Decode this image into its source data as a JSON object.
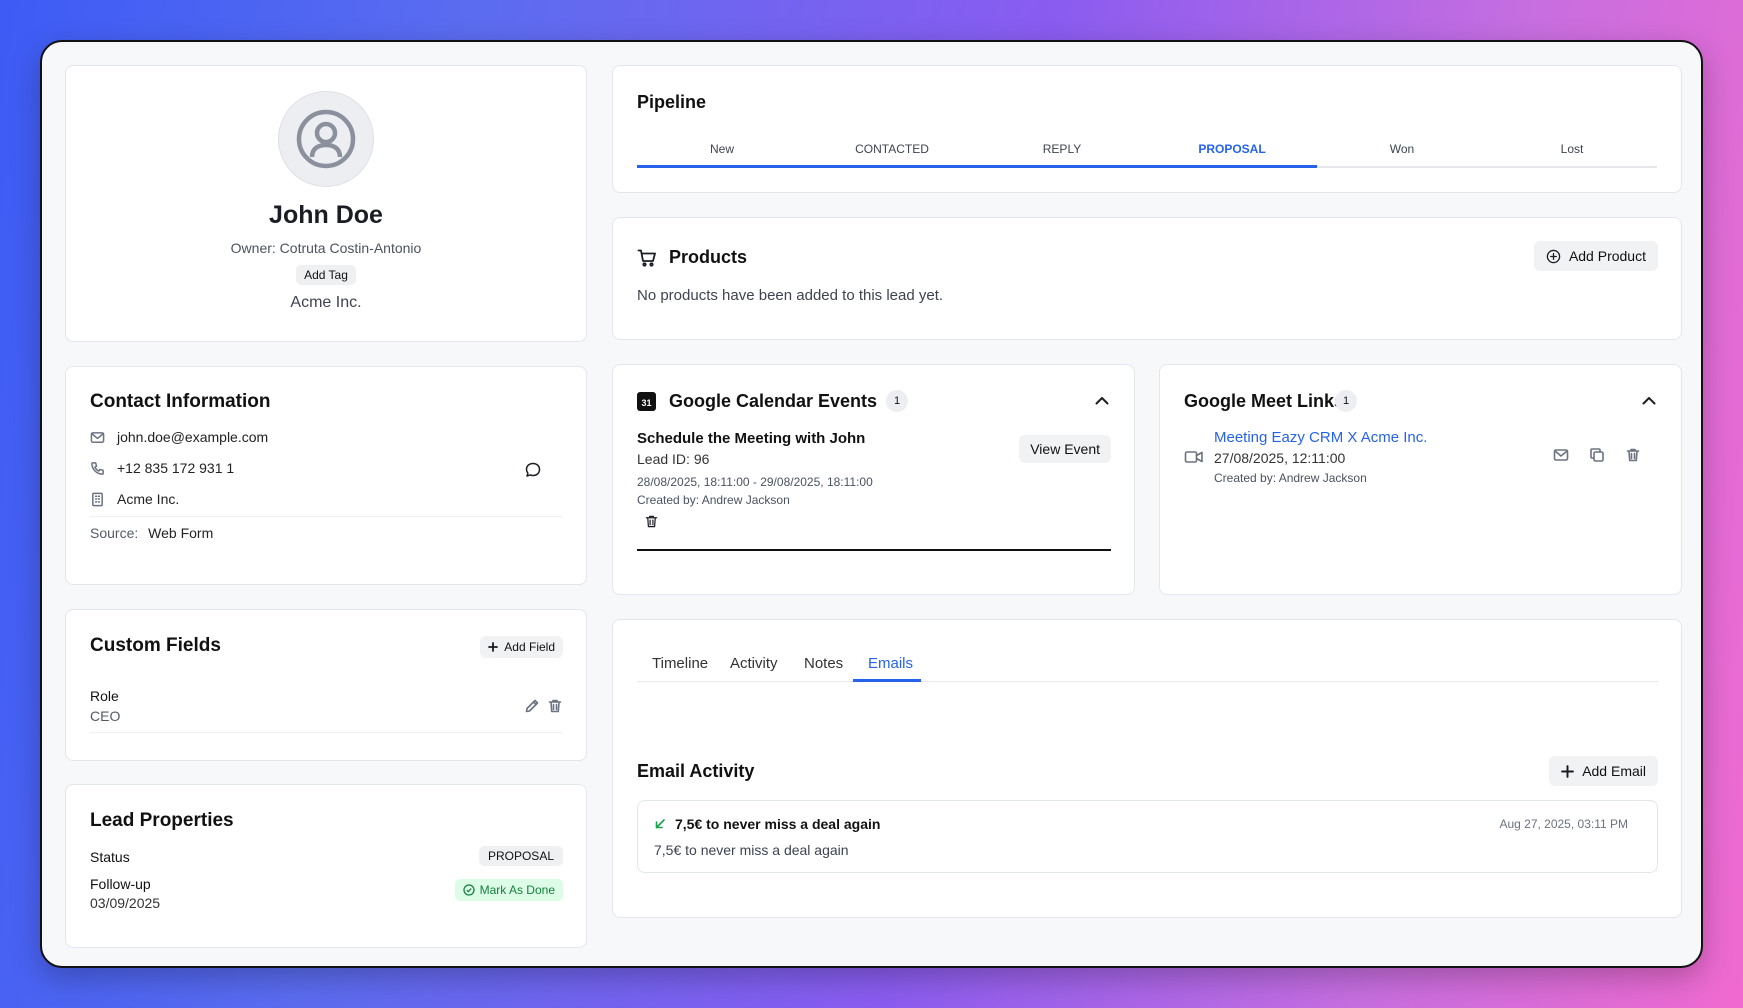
{
  "profile": {
    "name": "John Doe",
    "owner": "Owner: Cotruta Costin-Antonio",
    "add_tag_label": "Add Tag",
    "company": "Acme Inc."
  },
  "contact": {
    "title": "Contact Information",
    "email": "john.doe@example.com",
    "phone": "+12 835 172 931 1",
    "company": "Acme Inc.",
    "source_label": "Source:",
    "source_value": "Web Form"
  },
  "custom_fields": {
    "title": "Custom Fields",
    "add_label": "Add Field",
    "fields": [
      {
        "label": "Role",
        "value": "CEO"
      }
    ]
  },
  "lead_properties": {
    "title": "Lead Properties",
    "status_label": "Status",
    "status_value": "PROPOSAL",
    "followup_label": "Follow-up",
    "followup_date": "03/09/2025",
    "mark_done_label": "Mark As Done",
    "mark_done_color": "#16a34a"
  },
  "pipeline": {
    "title": "Pipeline",
    "stages": [
      "New",
      "CONTACTED",
      "REPLY",
      "PROPOSAL",
      "Won",
      "Lost"
    ],
    "active_stage": "PROPOSAL",
    "accent_color": "#2563eb"
  },
  "products": {
    "title": "Products",
    "add_label": "Add Product",
    "empty_text": "No products have been added to this lead yet."
  },
  "calendar": {
    "title": "Google Calendar Events",
    "count": "1",
    "icon_text": "31",
    "event": {
      "title": "Schedule the Meeting with John",
      "lead_id": "Lead ID: 96",
      "range": "28/08/2025, 18:11:00 - 29/08/2025, 18:11:00",
      "created_by": "Created by: Andrew Jackson",
      "view_label": "View Event"
    }
  },
  "meet": {
    "title": "Google Meet Links",
    "count": "1",
    "link": {
      "title": "Meeting Eazy CRM X Acme Inc.",
      "datetime": "27/08/2025, 12:11:00",
      "created_by": "Created by: Andrew Jackson"
    }
  },
  "tabs": {
    "items": [
      "Timeline",
      "Activity",
      "Notes",
      "Emails"
    ],
    "active": "Emails"
  },
  "emails": {
    "title": "Email Activity",
    "add_label": "Add Email",
    "items": [
      {
        "subject": "7,5€ to never miss a deal again",
        "preview": "7,5€ to never miss a deal again",
        "date": "Aug 27, 2025, 03:11 PM",
        "direction_color": "#16a34a"
      }
    ]
  }
}
